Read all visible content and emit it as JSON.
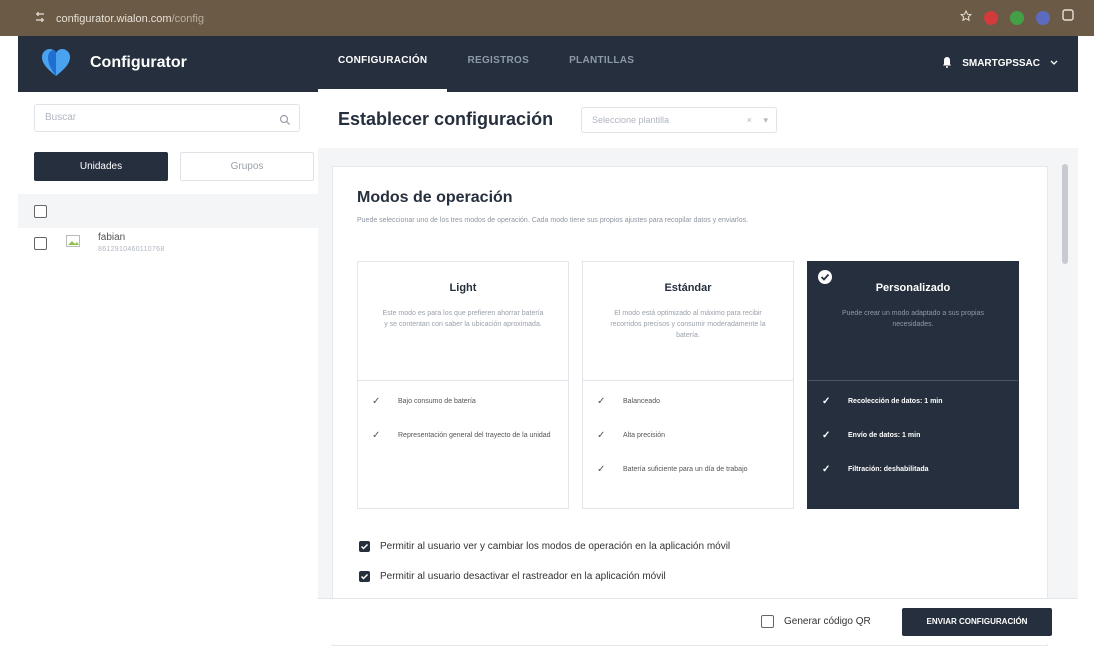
{
  "browser": {
    "url_host": "configurator.wialon.com",
    "url_path": "/config"
  },
  "app": {
    "brand": "Configurator",
    "user": "SMARTGPSSAC"
  },
  "nav": {
    "tabs": [
      {
        "label": "CONFIGURACIÓN",
        "active": true
      },
      {
        "label": "REGISTROS",
        "active": false
      },
      {
        "label": "PLANTILLAS",
        "active": false
      }
    ]
  },
  "sidebar": {
    "search_placeholder": "Buscar",
    "segments": {
      "units": "Unidades",
      "groups": "Grupos",
      "selected": "units"
    },
    "units": [
      {
        "name": "fabian",
        "id": "8612910460110768"
      }
    ]
  },
  "main": {
    "title": "Establecer configuración",
    "template_placeholder": "Seleccione plantilla",
    "card": {
      "title": "Modos de operación",
      "subtitle": "Puede seleccionar uno de los tres modos de operación. Cada modo tiene sus propios ajustes para recopilar datos y enviarlos.",
      "modes": [
        {
          "title": "Light",
          "description": "Este modo es para los que prefieren ahorrar batería y se contentan con saber la ubicación aproximada.",
          "features": [
            "Bajo consumo de batería",
            "Representación general del trayecto de la unidad"
          ],
          "selected": false
        },
        {
          "title": "Estándar",
          "description": "El modo está optimizado al máximo para recibir recorridos precisos y consumir moderadamente la batería.",
          "features": [
            "Balanceado",
            "Alta precisión",
            "Batería suficiente para un día de trabajo"
          ],
          "selected": false
        },
        {
          "title": "Personalizado",
          "description": "Puede crear un modo adaptado a sus propias necesidades.",
          "features": [
            "Recolección de datos: 1 min",
            "Envío de datos: 1 min",
            "Filtración: deshabilitada"
          ],
          "selected": true
        }
      ],
      "permissions": [
        {
          "label": "Permitir al usuario ver y cambiar los modos de operación en la aplicación móvil",
          "checked": true
        },
        {
          "label": "Permitir al usuario desactivar el rastreador en la aplicación móvil",
          "checked": true
        }
      ]
    }
  },
  "footer": {
    "qr_label": "Generar código QR",
    "qr_checked": false,
    "send_label": "ENVIAR CONFIGURACIÓN"
  },
  "colors": {
    "dark": "#262f3d",
    "browser_bar": "#6b5a45"
  },
  "icons": [
    "search-icon",
    "bell-icon",
    "chevron-down-icon",
    "check-icon",
    "checkbox-icon"
  ]
}
